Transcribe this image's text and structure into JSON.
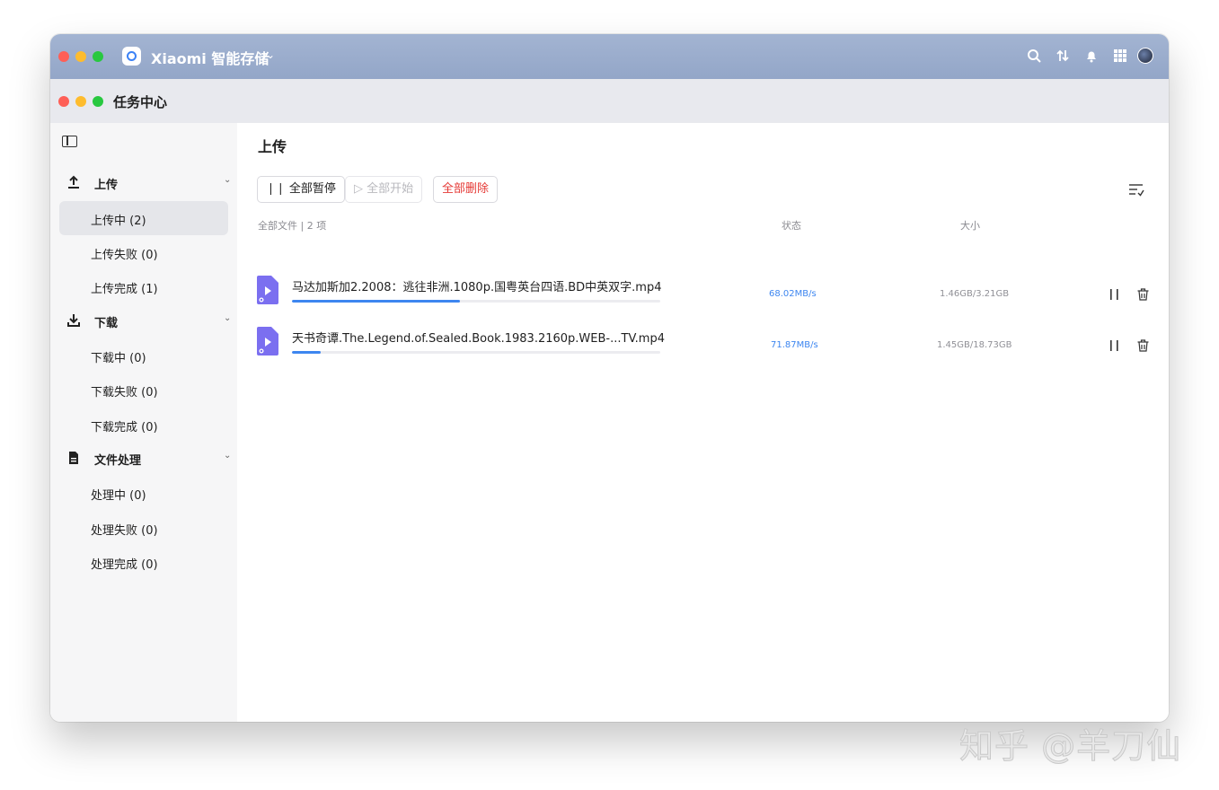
{
  "titlebar": {
    "app_name": "Xiaomi 智能存储",
    "icons": [
      "search-icon",
      "transfer-icon",
      "bell-icon",
      "apps-grid-icon",
      "avatar"
    ]
  },
  "task_window": {
    "title": "任务中心"
  },
  "sidebar": {
    "sections": [
      {
        "label": "上传",
        "icon": "upload-icon",
        "items": [
          {
            "label": "上传中 (2)",
            "active": true
          },
          {
            "label": "上传失败 (0)"
          },
          {
            "label": "上传完成 (1)"
          }
        ]
      },
      {
        "label": "下载",
        "icon": "download-icon",
        "items": [
          {
            "label": "下载中 (0)"
          },
          {
            "label": "下载失败 (0)"
          },
          {
            "label": "下载完成 (0)"
          }
        ]
      },
      {
        "label": "文件处理",
        "icon": "document-icon",
        "items": [
          {
            "label": "处理中 (0)"
          },
          {
            "label": "处理失败 (0)"
          },
          {
            "label": "处理完成 (0)"
          }
        ]
      }
    ]
  },
  "main": {
    "title": "上传",
    "toolbar": {
      "pause_all": "❘❘ 全部暂停",
      "start_all": "▷ 全部开始",
      "delete_all": "全部删除"
    },
    "columns": {
      "files": "全部文件 | 2 项",
      "status": "状态",
      "size": "大小"
    },
    "rows": [
      {
        "name": "马达加斯加2.2008：逃往非洲.1080p.国粤英台四语.BD中英双字.mp4",
        "speed": "68.02MB/s",
        "size": "1.46GB/3.21GB",
        "progress": 0.455
      },
      {
        "name": "天书奇谭.The.Legend.of.Sealed.Book.1983.2160p.WEB-...TV.mp4",
        "speed": "71.87MB/s",
        "size": "1.45GB/18.73GB",
        "progress": 0.077
      }
    ]
  },
  "colors": {
    "accent": "#3d86f0",
    "danger": "#e53935",
    "titlebar": "#99abcb"
  },
  "watermark": "知乎 @羊刀仙"
}
